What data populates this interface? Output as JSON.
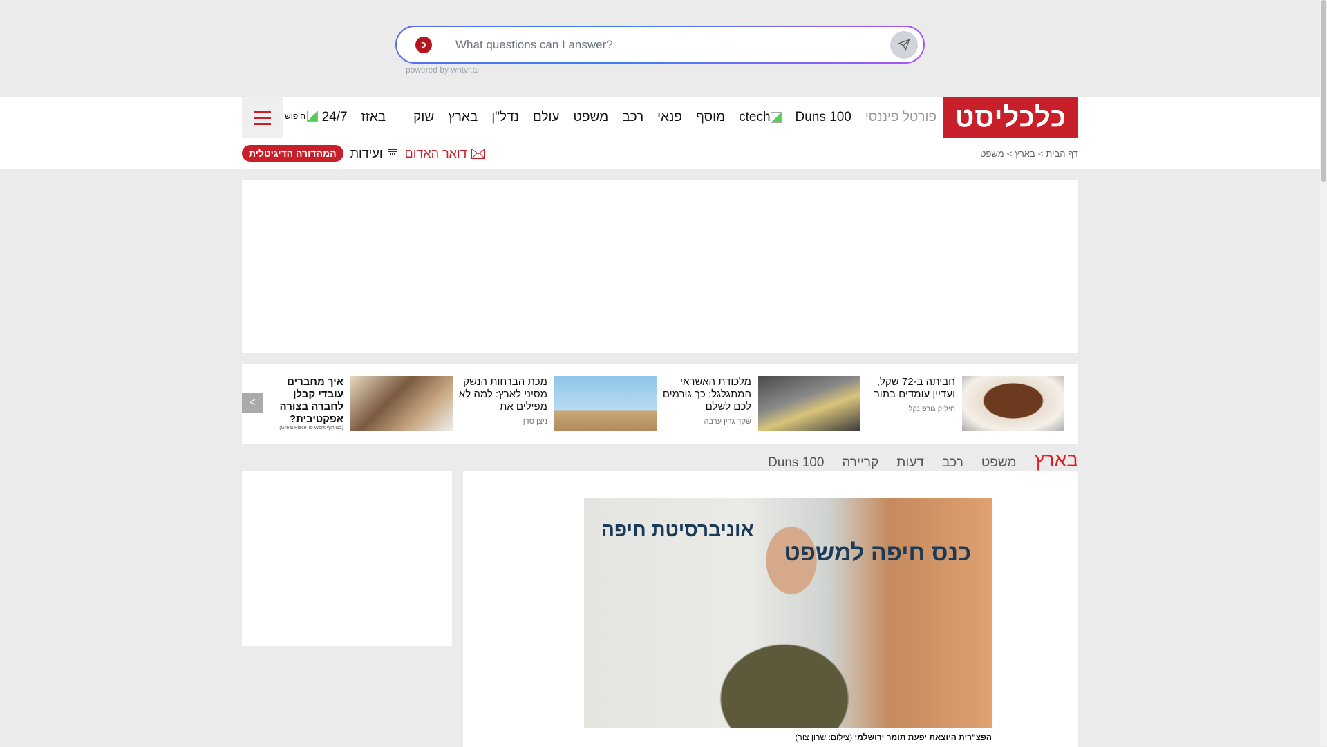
{
  "assistant": {
    "placeholder": "What questions can I answer?",
    "powered_by": "powered by whtvr.ai",
    "logo_letter": "כ"
  },
  "header": {
    "logo": "כלכליסט",
    "nav": [
      "24/7",
      "באזז",
      "שוק",
      "בארץ",
      "נדל\"ן",
      "עולם",
      "משפט",
      "רכב",
      "פנאי",
      "מוסף",
      "ctech",
      "Duns 100",
      "פורטל פיננסי"
    ],
    "search_label": "חיפוש"
  },
  "breadcrumb": [
    "דף הבית",
    "בארץ",
    "משפט"
  ],
  "tools": {
    "red_mail": "דואר האדום",
    "events": "ועידות",
    "digital_edition": "המהדורה הדיגיטלית"
  },
  "carousel": [
    {
      "title": "חביתה ב-72 שקל, ועדיין עומדים בתור",
      "author": "חיליק גורפינקל",
      "img": "#8a5a3a"
    },
    {
      "title": "מלכודת האשראי המתגלגל: כך גורמים לכם לשלם",
      "author": "שקד גרין ערבה",
      "img": "#555"
    },
    {
      "title": "מכת הברחות הנשק מסיני לארץ: למה לא מפילים את",
      "author": "ניצן סדן",
      "img": "#8fc6ea"
    },
    {
      "title": "איך מחברים עובדי קבלן לחברה בצורה אפקטיבית?",
      "author": "(בשיתוף Great Place To Work)",
      "img": "#b9926a"
    }
  ],
  "sections": [
    "בארץ",
    "משפט",
    "רכב",
    "דעות",
    "קריירה",
    "Duns 100"
  ],
  "article": {
    "caption_bold": "הפצ\"רית היוצאת יפעת תומר ירושלמי",
    "caption_credit": "(צילום: שרון צור)",
    "photo_sign_1": "אוניברסיטת חיפה",
    "photo_sign_2": "כנס חיפה למשפט"
  },
  "colors": {
    "brand": "#c8202a",
    "active_section": "#e41b1b"
  }
}
